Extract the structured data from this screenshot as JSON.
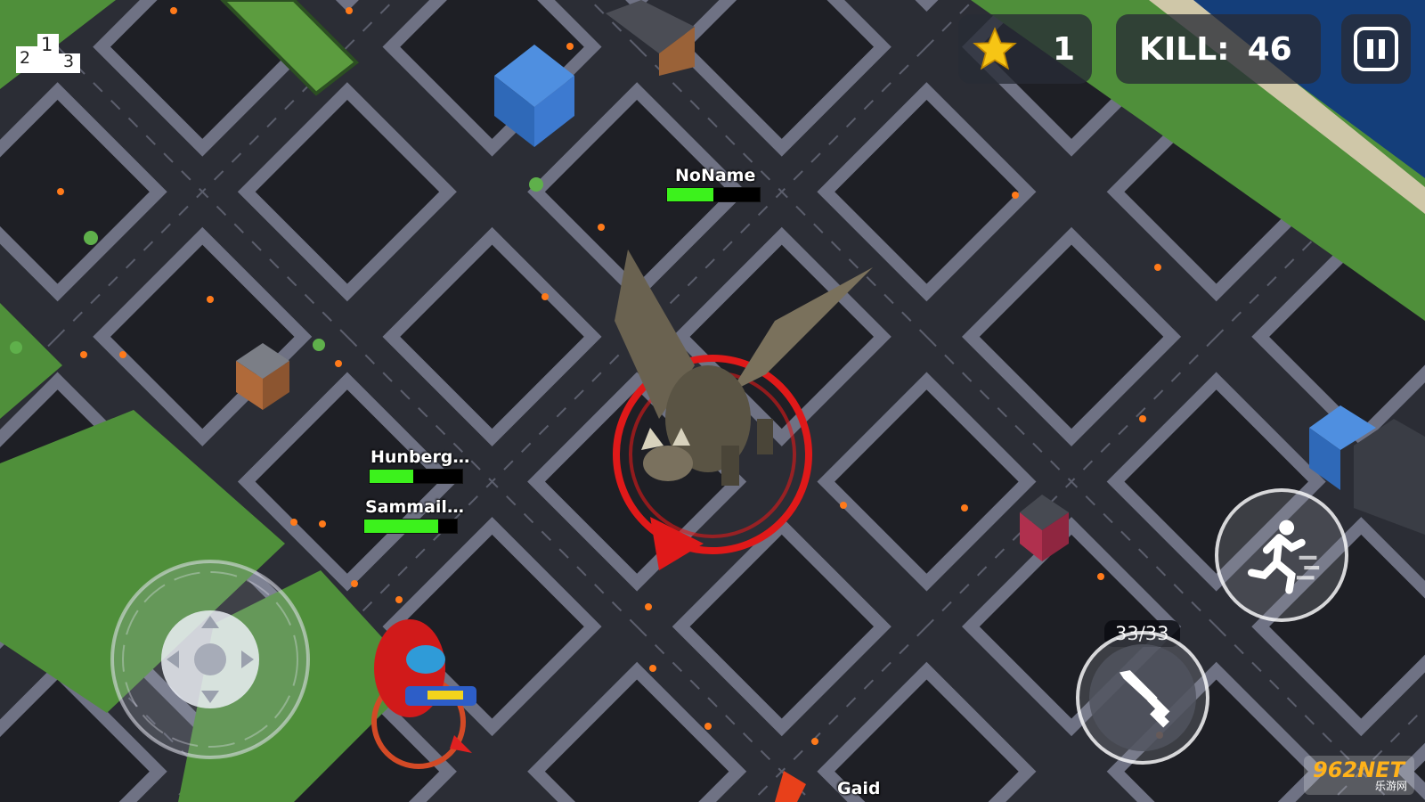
{
  "hud": {
    "leaderboard_positions": [
      "2",
      "1",
      "3"
    ],
    "stars": "1",
    "kill_label": "KILL:",
    "kill_count": "46",
    "pause_icon": "pause-icon"
  },
  "players": [
    {
      "name": "NoName",
      "health": 0.5
    },
    {
      "name": "Hunberg…",
      "health": 0.47
    },
    {
      "name": "Sammail…",
      "health": 0.8
    },
    {
      "name": "Gaid",
      "health": null
    }
  ],
  "controls": {
    "joystick_icon": "dpad-icon",
    "sprint_icon": "running-man-icon",
    "attack_icon": "sword-icon",
    "ammo": "33/33"
  },
  "watermark": {
    "main": "962NET",
    "sub": "乐游网"
  },
  "colors": {
    "accent_red": "#e01919",
    "health_green": "#3cf21c",
    "road": "#2b2d35",
    "block": "#1e1f25",
    "grass": "#4f8f3a",
    "water": "#143e7a"
  }
}
